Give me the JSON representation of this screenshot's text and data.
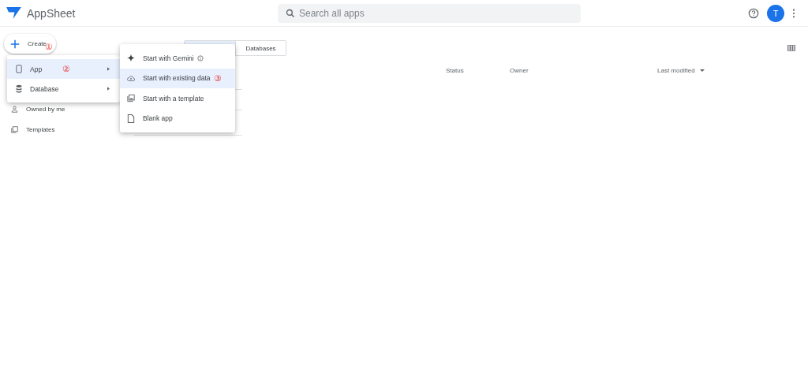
{
  "header": {
    "app_name": "AppSheet",
    "search": {
      "placeholder": "Search all apps"
    },
    "avatar": "T"
  },
  "create_button": {
    "label": "Create",
    "annotation": "①"
  },
  "sidebar": {
    "items": [
      {
        "label": "Owned by me",
        "kind": "person"
      },
      {
        "label": "Templates",
        "kind": "template"
      }
    ]
  },
  "view_toggle": [
    {
      "selected": true
    },
    {
      "label": "Databases",
      "selected": false
    }
  ],
  "table": {
    "columns": [
      {
        "label": "Status",
        "sorted": false
      },
      {
        "label": "Owner",
        "sorted": false
      },
      {
        "label": "Last modified",
        "sorted": true
      }
    ]
  },
  "create_menu": [
    {
      "label": "App",
      "kind": "phone",
      "selected": true,
      "annotation": "②"
    },
    {
      "label": "Database",
      "kind": "database",
      "selected": false
    }
  ],
  "app_submenu": [
    {
      "label": "Start with Gemini",
      "kind": "sparkle",
      "selected": false,
      "info": true
    },
    {
      "label": "Start with existing data",
      "kind": "cloud",
      "selected": true,
      "info": false,
      "annotation": "③"
    },
    {
      "label": "Start with a template",
      "kind": "template",
      "selected": false,
      "info": false
    },
    {
      "label": "Blank app",
      "kind": "file",
      "selected": false,
      "info": false
    }
  ]
}
